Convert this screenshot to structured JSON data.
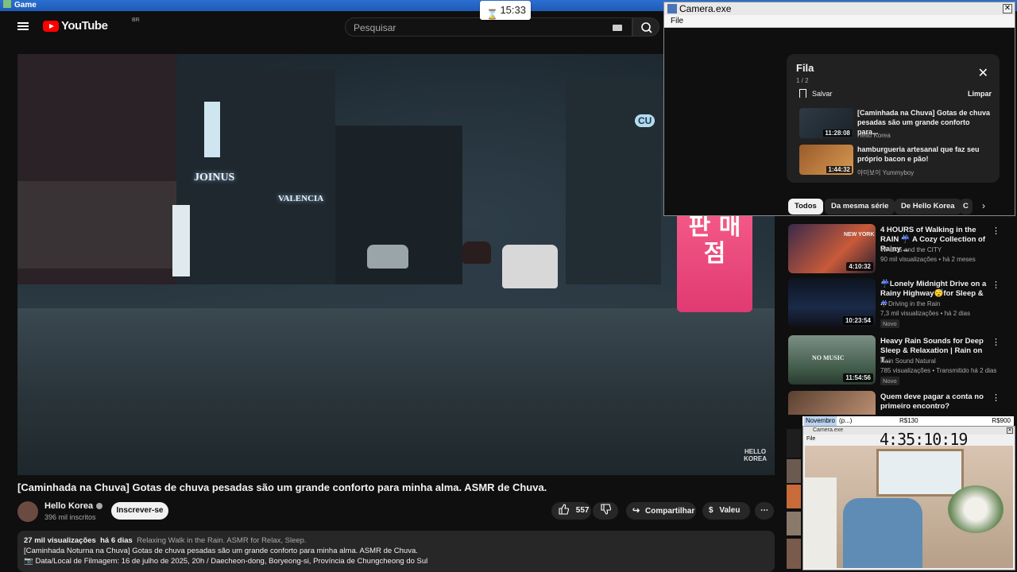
{
  "game_window": {
    "title": "Game"
  },
  "timer": {
    "value": "15:33"
  },
  "header": {
    "logo_text": "YouTube",
    "logo_region": "BR",
    "search_placeholder": "Pesquisar"
  },
  "video": {
    "watermark_line1": "HELLO",
    "watermark_line2": "KOREA",
    "scene_sign_pink": "대 박\n복 권\n판 매\n점",
    "scene_sign_joinus": "JOINUS",
    "scene_sign_valencia": "VALENCIA",
    "scene_sign_cu": "CU",
    "title": "[Caminhada na Chuva] Gotas de chuva pesadas são um grande conforto para minha alma. ASMR de Chuva."
  },
  "channel": {
    "name": "Hello Korea",
    "subscribers": "396 mil inscritos",
    "subscribe_label": "Inscrever-se"
  },
  "actions": {
    "likes": "557",
    "share_label": "Compartilhar",
    "thanks_label": "Valeu",
    "more_label": "⋯"
  },
  "description": {
    "views": "27 mil visualizações",
    "age": "há 6 dias",
    "tags": "Relaxing Walk in the Rain. ASMR for Relax, Sleep.",
    "line1": "[Caminhada Noturna na Chuva] Gotas de chuva pesadas são um grande conforto para minha alma. ASMR de Chuva.",
    "line2": "📷 Data/Local de Filmagem: 16 de julho de 2025, 20h / Daecheon-dong, Boryeong-si, Província de Chungcheong do Sul"
  },
  "camera_window": {
    "title": "Camera.exe",
    "menu_file": "File",
    "close": "✕"
  },
  "queue": {
    "title": "Fila",
    "count": "1 / 2",
    "save_label": "Salvar",
    "clear_label": "Limpar",
    "items": [
      {
        "title": "[Caminhada na Chuva] Gotas de chuva pesadas são um grande conforto para...",
        "channel": "Hello Korea",
        "duration": "11:28:08"
      },
      {
        "title": "hamburgueria artesanal que faz seu próprio bacon e pão!",
        "channel": "야미보이 Yummyboy",
        "duration": "1:44:32"
      }
    ]
  },
  "chips": [
    "Todos",
    "Da mesma série",
    "De Hello Korea",
    "C"
  ],
  "recommendations": [
    {
      "title": "4 HOURS of Walking in the RAIN ☔ A Cozy Collection of Rainy ...",
      "channel": "WALKS and the CITY",
      "meta": "90 mil visualizações • há 2 meses",
      "duration": "4:10:32",
      "badge": "",
      "thumb_text": "NEW YORK"
    },
    {
      "title": "☔Lonely Midnight Drive on a Rainy Highway😴for Sleep & ...",
      "channel": "☔Driving in the Rain",
      "meta": "7,3 mil visualizações • há 2 dias",
      "duration": "10:23:54",
      "badge": "Novo",
      "thumb_text": ""
    },
    {
      "title": "Heavy Rain Sounds for Deep Sleep & Relaxation | Rain on T...",
      "channel": "Rain Sound Natural",
      "meta": "785 visualizações • Transmitido há 2 dias",
      "duration": "11:54:56",
      "badge": "Novo",
      "thumb_text": "NO MUSIC"
    },
    {
      "title": "Quem deve pagar a conta no primeiro encontro?",
      "channel": "",
      "meta": "",
      "duration": "",
      "badge": "",
      "thumb_text": ""
    }
  ],
  "sheet": {
    "month": "Novembro",
    "note": "(p...)",
    "v1": "R$130",
    "v2": "R$900"
  },
  "camera2": {
    "title": "Camera.exe",
    "menu_file": "File",
    "clock": "4:35:10:19"
  }
}
